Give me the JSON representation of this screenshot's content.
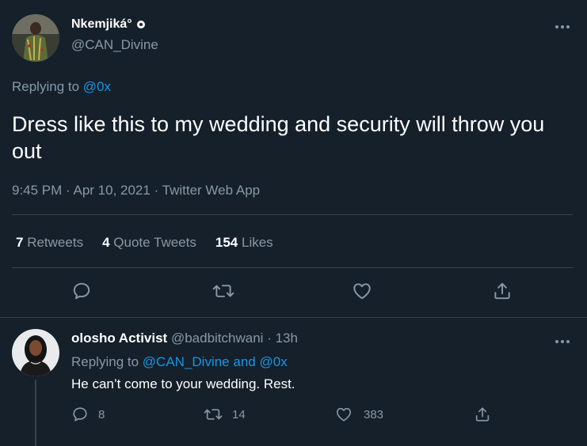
{
  "main_tweet": {
    "author_name": "Nkemjiká°",
    "handle": "@CAN_Divine",
    "replying_prefix": "Replying to",
    "replying_to": "@0x",
    "text": "Dress like this to my wedding and security will throw you out",
    "meta": "9:45 PM · Apr 10, 2021 · Twitter Web App",
    "stats": {
      "retweets_count": "7",
      "retweets_label": "Retweets",
      "quotes_count": "4",
      "quotes_label": "Quote Tweets",
      "likes_count": "154",
      "likes_label": "Likes"
    }
  },
  "reply": {
    "author_name": "olosho Activist",
    "handle": "@badbitchwani",
    "time": "· 13h",
    "replying_prefix": "Replying to",
    "replying_to_1": "@CAN_Divine",
    "replying_and": "and",
    "replying_to_2": "@0x",
    "text": "He can’t come to your wedding. Rest.",
    "reply_count": "8",
    "retweet_count": "14",
    "like_count": "383"
  },
  "icons": {
    "more": "more-horizontal-icon",
    "verified": "badge-icon",
    "reply": "reply-icon",
    "retweet": "retweet-icon",
    "like": "heart-icon",
    "share": "share-icon"
  },
  "colors": {
    "background": "#15202b",
    "text": "#ffffff",
    "muted": "#8899a6",
    "link": "#1b95e0",
    "divider": "#38444d"
  }
}
